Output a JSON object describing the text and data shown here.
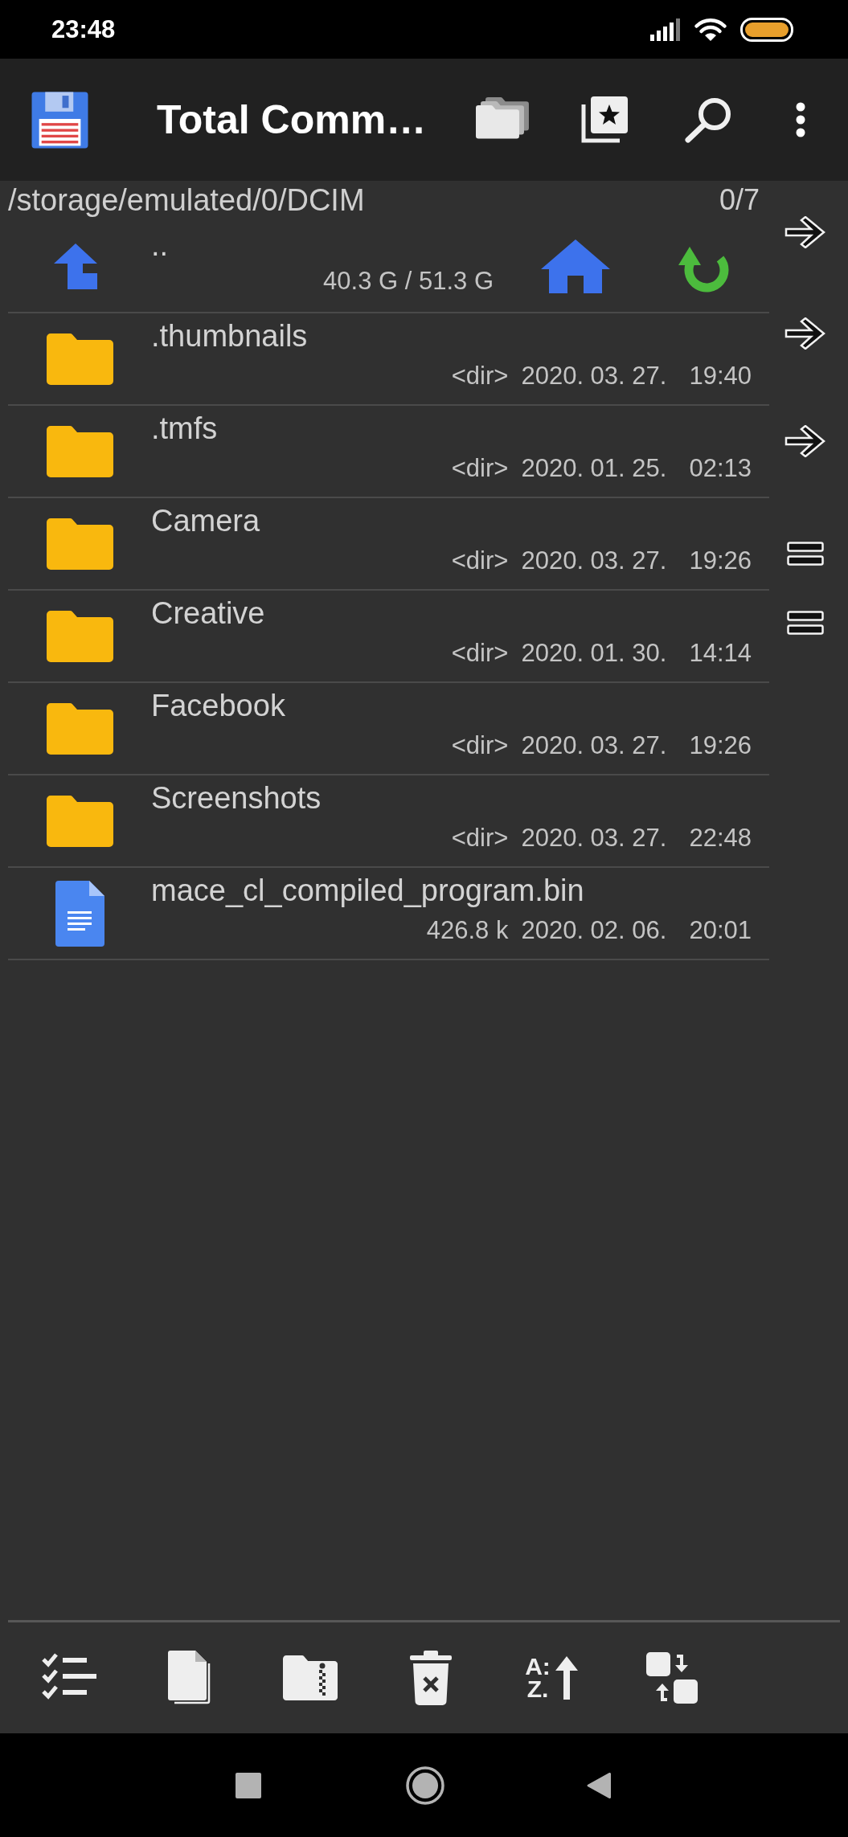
{
  "status_bar": {
    "time": "23:48"
  },
  "app_bar": {
    "title": "Total Comm…"
  },
  "panel": {
    "path": "/storage/emulated/0/DCIM",
    "selection_count": "0/7",
    "parent_row": {
      "name": "..",
      "free_space": "40.3 G / 51.3 G"
    },
    "items": [
      {
        "kind": "folder",
        "name": ".thumbnails",
        "size": "<dir>",
        "date": "2020. 03. 27.",
        "time": "19:40",
        "selected": false
      },
      {
        "kind": "folder",
        "name": ".tmfs",
        "size": "<dir>",
        "date": "2020. 01. 25.",
        "time": "02:13",
        "selected": false
      },
      {
        "kind": "folder",
        "name": "Camera",
        "size": "<dir>",
        "date": "2020. 03. 27.",
        "time": "19:26",
        "selected": false
      },
      {
        "kind": "folder",
        "name": "Creative",
        "size": "<dir>",
        "date": "2020. 01. 30.",
        "time": "14:14",
        "selected": false
      },
      {
        "kind": "folder",
        "name": "Facebook",
        "size": "<dir>",
        "date": "2020. 03. 27.",
        "time": "19:26",
        "selected": false
      },
      {
        "kind": "folder",
        "name": "Screenshots",
        "size": "<dir>",
        "date": "2020. 03. 27.",
        "time": "22:48",
        "selected": false
      },
      {
        "kind": "file",
        "name": "mace_cl_compiled_program.bin",
        "size": "426.8 k",
        "date": "2020. 02. 06.",
        "time": "20:01",
        "selected": false
      }
    ]
  },
  "bottom_toolbar": {
    "sort_letters": [
      "A:",
      "Z."
    ]
  }
}
